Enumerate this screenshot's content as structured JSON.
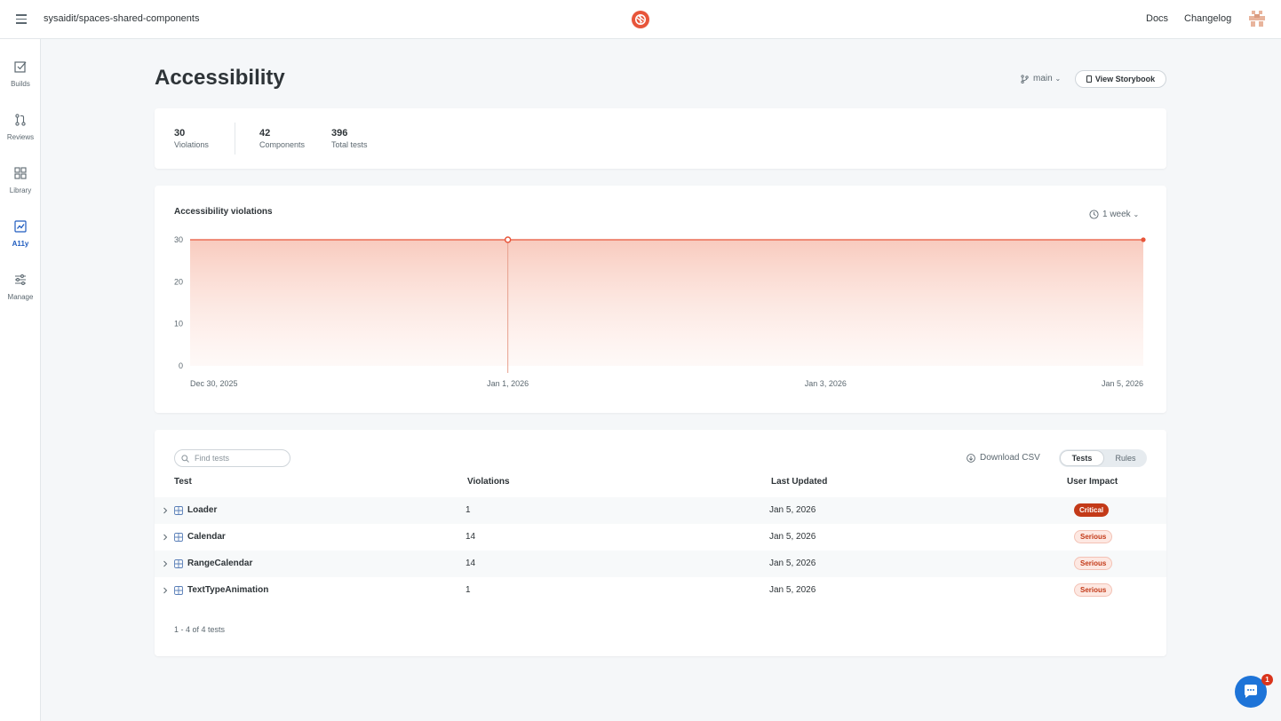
{
  "topbar": {
    "repo": "sysaidit/spaces-shared-components",
    "links": [
      "Docs",
      "Changelog"
    ]
  },
  "sidebar": {
    "items": [
      {
        "label": "Builds",
        "icon": "check-square-icon"
      },
      {
        "label": "Reviews",
        "icon": "pull-request-icon"
      },
      {
        "label": "Library",
        "icon": "grid-icon"
      },
      {
        "label": "A11y",
        "icon": "chart-line-icon"
      },
      {
        "label": "Manage",
        "icon": "sliders-icon"
      }
    ],
    "active": "A11y"
  },
  "page": {
    "title": "Accessibility",
    "branch": "main",
    "view_storybook": "View Storybook"
  },
  "stats": [
    {
      "value": "30",
      "label": "Violations"
    },
    {
      "value": "42",
      "label": "Components"
    },
    {
      "value": "396",
      "label": "Total tests"
    }
  ],
  "chart_header": {
    "title": "Accessibility violations",
    "range": "1 week"
  },
  "chart_data": {
    "type": "area",
    "title": "Accessibility violations",
    "xlabel": "",
    "ylabel": "",
    "x_ticks": [
      "Dec 30, 2025",
      "Jan 1, 2026",
      "Jan 3, 2026",
      "Jan 5, 2026"
    ],
    "y_ticks": [
      0,
      10,
      20,
      30
    ],
    "ylim": [
      0,
      30
    ],
    "xlim": [
      "2025-12-30",
      "2026-01-05"
    ],
    "series": [
      {
        "x": [
          "2025-12-30",
          "2026-01-01",
          "2026-01-05"
        ],
        "values": [
          30,
          30,
          30
        ]
      }
    ],
    "highlight": "2026-01-01",
    "grid": false,
    "color": "#e7553a"
  },
  "tests": {
    "search_placeholder": "Find tests",
    "download": "Download CSV",
    "toggle": [
      "Tests",
      "Rules"
    ],
    "columns": [
      "Test",
      "Violations",
      "Last Updated",
      "User Impact"
    ],
    "rows": [
      {
        "name": "Loader",
        "violations": "1",
        "updated": "Jan 5, 2026",
        "impact": "Critical"
      },
      {
        "name": "Calendar",
        "violations": "14",
        "updated": "Jan 5, 2026",
        "impact": "Serious"
      },
      {
        "name": "RangeCalendar",
        "violations": "14",
        "updated": "Jan 5, 2026",
        "impact": "Serious"
      },
      {
        "name": "TextTypeAnimation",
        "violations": "1",
        "updated": "Jan 5, 2026",
        "impact": "Serious"
      }
    ],
    "pager": "1 - 4 of 4 tests"
  },
  "chat": {
    "badge": "1"
  }
}
